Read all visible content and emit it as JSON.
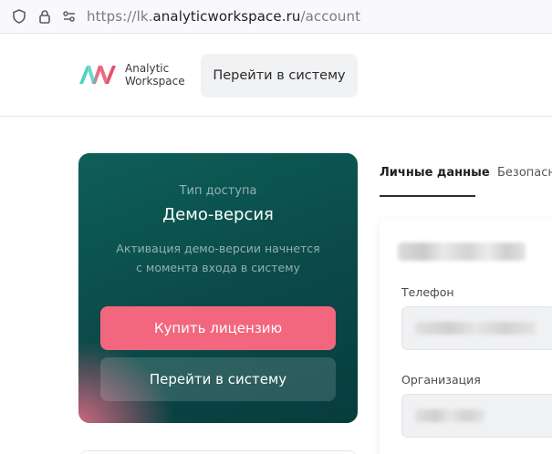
{
  "browser": {
    "url_prefix": "https://lk.",
    "url_host": "analyticworkspace.ru",
    "url_path": "/account"
  },
  "header": {
    "logo_line1": "Analytic",
    "logo_line2": "Workspace",
    "goto_label": "Перейти в систему"
  },
  "access_card": {
    "label": "Тип доступа",
    "title": "Демо-версия",
    "description": "Активация демо-версии начнется с момента входа в систему",
    "buy_label": "Купить лицензию",
    "goto_label": "Перейти в систему",
    "colors": {
      "card_start": "#0e5f59",
      "card_end": "#073c3d",
      "buy_button": "#f2677e"
    }
  },
  "tabs": [
    {
      "label": "Личные данные",
      "active": true
    },
    {
      "label": "Безопасн",
      "active": false
    }
  ],
  "profile": {
    "phone_label": "Телефон",
    "org_label": "Организация"
  },
  "icons": [
    "shield-icon",
    "lock-icon",
    "permissions-icon"
  ]
}
